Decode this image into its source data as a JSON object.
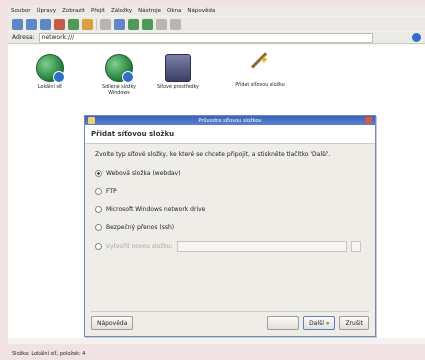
{
  "menubar": {
    "items": [
      "Soubor",
      "Úpravy",
      "Zobrazit",
      "Přejít",
      "Záložky",
      "Nástroje",
      "Okna",
      "Nápověda"
    ]
  },
  "toolbar": {
    "icons": [
      "back-icon",
      "forward-icon",
      "up-icon",
      "stop-icon",
      "reload-icon",
      "home-icon",
      "computer-icon",
      "search-icon",
      "zoom-in-icon",
      "zoom-out-icon",
      "view-icon",
      "list-icon"
    ]
  },
  "location": {
    "label": "Adresa:",
    "value": "network:///"
  },
  "icons": [
    {
      "label": "Lokální síť",
      "kind": "network"
    },
    {
      "label": "Sdílené složky Windows",
      "kind": "network"
    },
    {
      "label": "Síťové prostředky",
      "kind": "computer"
    },
    {
      "label": "Přidat síťovou složku",
      "kind": "wizard"
    }
  ],
  "dialog": {
    "title": "Průvodce síťovou složkou",
    "header": "Přidat síťovou složku",
    "instruction": "Zvolte typ síťové složky, ke které se chcete připojit, a stiskněte tlačítko 'Další'.",
    "options": [
      {
        "label": "Webová složka (webdav)",
        "selected": true
      },
      {
        "label": "FTP",
        "selected": false
      },
      {
        "label": "Microsoft Windows network drive",
        "selected": false
      },
      {
        "label": "Bezpečný přenos (ssh)",
        "selected": false
      }
    ],
    "disabled_label": "Vytvořit novou složku:",
    "buttons": {
      "help": "Nápověda",
      "next": "Další",
      "cancel": "Zrušit"
    }
  },
  "statusbar": {
    "text": "Složka: Lokální síť, položek: 4"
  },
  "colors": {
    "accent": "#3a63b8",
    "background": "#f1e3e4"
  }
}
